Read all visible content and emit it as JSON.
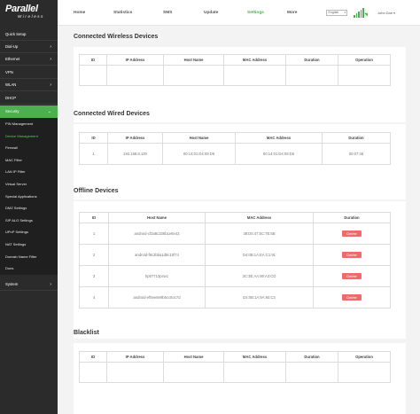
{
  "brand": {
    "name": "Parallel",
    "subtitle": "Wireless"
  },
  "nav": {
    "tabs": [
      {
        "label": "Home"
      },
      {
        "label": "Statistics"
      },
      {
        "label": "SMS"
      },
      {
        "label": "Update"
      },
      {
        "label": "Settings",
        "active": true
      },
      {
        "label": "More"
      }
    ],
    "language": "English",
    "user": "John Doe",
    "signal_bars": 5
  },
  "sidebar": {
    "items": [
      {
        "label": "Quick Setup"
      },
      {
        "label": "Dial-Up"
      },
      {
        "label": "Ethernet"
      },
      {
        "label": "VPN"
      },
      {
        "label": "WLAN"
      },
      {
        "label": "DHCP"
      },
      {
        "label": "Security",
        "active": true
      },
      {
        "label": "System"
      }
    ],
    "security_sub": [
      {
        "label": "PIN Management"
      },
      {
        "label": "Device Management",
        "current": true
      },
      {
        "label": "Firewall"
      },
      {
        "label": "MAC Filter"
      },
      {
        "label": "LAN IP Filter"
      },
      {
        "label": "Virtual Server"
      },
      {
        "label": "Special Applications"
      },
      {
        "label": "DMZ Settings"
      },
      {
        "label": "SIP ALG Settings"
      },
      {
        "label": "UPnP Settings"
      },
      {
        "label": "NAT Settings"
      },
      {
        "label": "Domain Name Filter"
      },
      {
        "label": "Dons"
      }
    ]
  },
  "sections": {
    "wireless": {
      "title": "Connected Wireless Devices",
      "columns": [
        "ID",
        "IP Address",
        "Host Name",
        "MAC Address",
        "Duration",
        "Operation"
      ]
    },
    "wired": {
      "title": "Connected Wired Devices",
      "columns": [
        "ID",
        "IP Address",
        "Host Name",
        "MAC Address",
        "Duration"
      ],
      "rows": [
        {
          "id": "1",
          "ip": "192.168.8.100",
          "host": "00:14:01:D4:09:D6",
          "mac": "00:14:01:D4:09:D6",
          "duration": "00:07:48"
        }
      ]
    },
    "offline": {
      "title": "Offline Devices",
      "columns": [
        "ID",
        "Host Name",
        "MAC Address",
        "Duration"
      ],
      "action_label": "Delete",
      "rows": [
        {
          "id": "1",
          "host": "android-cf3a8c336b1e6e43",
          "mac": "38:D5:47:5C:7E:5B"
        },
        {
          "id": "2",
          "host": "android-f8c2bba1d8c10f74",
          "mac": "D4:0B:1A:EA:C1:91"
        },
        {
          "id": "3",
          "host": "hp07713pcw1",
          "mac": "3C:3E:AA:86:A3:CD"
        },
        {
          "id": "4",
          "host": "android-ef5ee8e9b5cc5oc7d",
          "mac": "D4:0B:1A:9A:84:C3"
        }
      ]
    },
    "blacklist": {
      "title": "Blacklist",
      "columns": [
        "ID",
        "IP Address",
        "Host Name",
        "MAC Address",
        "Duration",
        "Operation"
      ]
    }
  }
}
